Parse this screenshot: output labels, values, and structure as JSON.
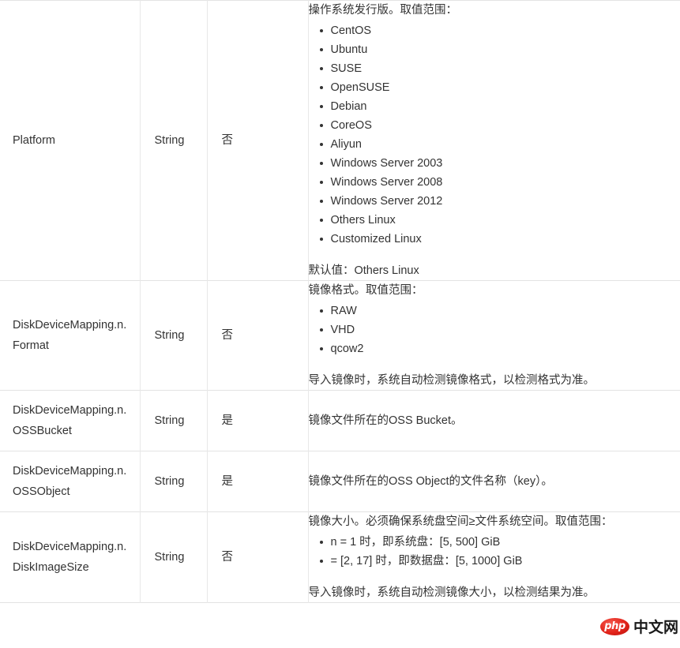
{
  "table": {
    "rows": [
      {
        "name": "Platform",
        "type": "String",
        "required": "否",
        "desc": {
          "lead": "操作系统发行版。取值范围：",
          "items": [
            "CentOS",
            "Ubuntu",
            "SUSE",
            "OpenSUSE",
            "Debian",
            "CoreOS",
            "Aliyun",
            "Windows Server 2003",
            "Windows Server 2008",
            "Windows Server 2012",
            "Others Linux",
            "Customized Linux"
          ],
          "foot": "默认值：Others Linux"
        }
      },
      {
        "name": "DiskDeviceMapping.n.Format",
        "type": "String",
        "required": "否",
        "desc": {
          "lead": "镜像格式。取值范围：",
          "items": [
            "RAW",
            "VHD",
            "qcow2"
          ],
          "foot": "导入镜像时，系统自动检测镜像格式，以检测格式为准。"
        }
      },
      {
        "name": "DiskDeviceMapping.n.OSSBucket",
        "type": "String",
        "required": "是",
        "desc": {
          "single": "镜像文件所在的OSS Bucket。"
        }
      },
      {
        "name": "DiskDeviceMapping.n.OSSObject",
        "type": "String",
        "required": "是",
        "desc": {
          "single": "镜像文件所在的OSS Object的文件名称（key）。"
        }
      },
      {
        "name": "DiskDeviceMapping.n.DiskImageSize",
        "type": "String",
        "required": "否",
        "desc": {
          "lead": "镜像大小。必须确保系统盘空间≥文件系统空间。取值范围：",
          "items": [
            "n = 1 时，即系统盘：[5, 500] GiB",
            "= [2, 17] 时，即数据盘：[5, 1000] GiB"
          ],
          "foot": "导入镜像时，系统自动检测镜像大小，以检测结果为准。"
        }
      }
    ]
  },
  "watermark": {
    "badge": "php",
    "text": "中文网",
    "badge_color": "#e2231a"
  }
}
